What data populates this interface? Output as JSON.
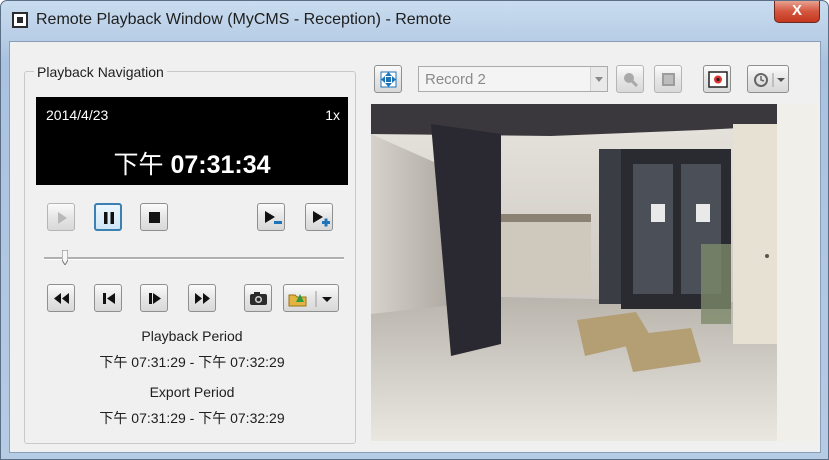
{
  "window": {
    "title": "Remote Playback Window (MyCMS - Reception) - Remote",
    "close_glyph": "X"
  },
  "navigation": {
    "group_title": "Playback Navigation",
    "display": {
      "date": "2014/4/23",
      "speed": "1x",
      "ampm": "下午",
      "time": "07:31:34"
    },
    "controls": {
      "row1": [
        "play-icon",
        "pause-icon",
        "stop-icon",
        "slow-down-icon",
        "speed-up-icon"
      ],
      "row2": [
        "fast-rewind-icon",
        "step-back-icon",
        "step-forward-icon",
        "fast-forward-icon",
        "camera-snapshot-icon",
        "export-folder-icon",
        "dropdown-arrow-icon"
      ]
    },
    "slider_position": 0.07,
    "playback_period_label": "Playback Period",
    "playback_period_value": "下午 07:31:29 - 下午 07:32:29",
    "export_period_label": "Export Period",
    "export_period_value": "下午 07:31:29 - 下午 07:32:29"
  },
  "toolbar": {
    "record_select_value": "Record 2",
    "icons": [
      "move-camera-icon",
      "tag-icon",
      "fullscreen-icon",
      "video-settings-icon",
      "time-settings-icon"
    ]
  },
  "colors": {
    "accent_blue": "#1f73b7",
    "display_bg": "#000000",
    "close_red": "#c4371f"
  }
}
